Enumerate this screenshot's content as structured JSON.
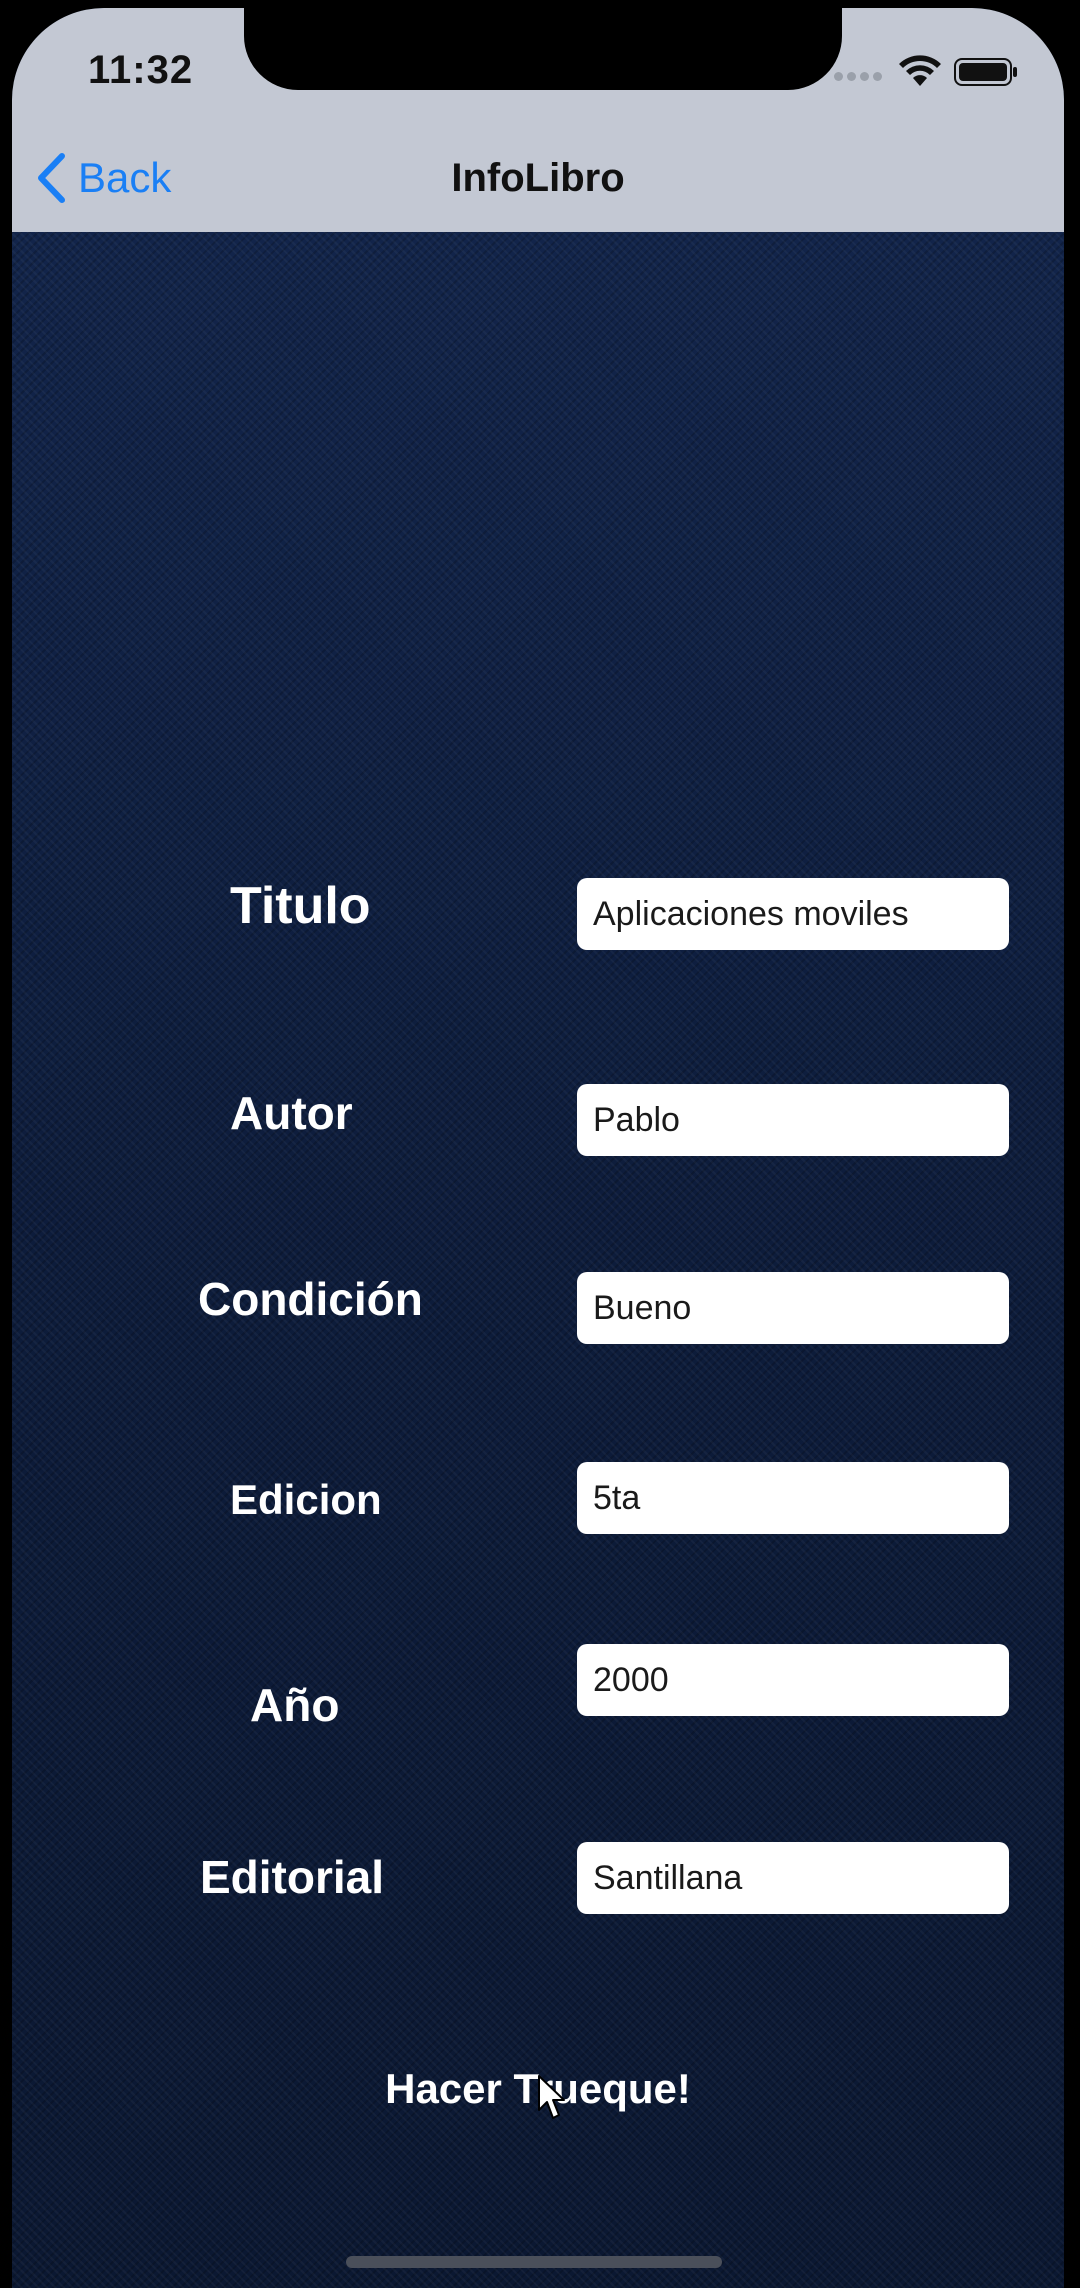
{
  "status_bar": {
    "time": "11:32"
  },
  "nav": {
    "back_label": "Back",
    "title": "InfoLibro"
  },
  "form": {
    "fields": [
      {
        "label": "Titulo",
        "value": "Aplicaciones moviles"
      },
      {
        "label": "Autor",
        "value": "Pablo"
      },
      {
        "label": "Condición",
        "value": "Bueno"
      },
      {
        "label": "Edicion",
        "value": "5ta"
      },
      {
        "label": "Año",
        "value": "2000"
      },
      {
        "label": "Editorial",
        "value": "Santillana"
      }
    ]
  },
  "action": {
    "trade_label": "Hacer Trueque!"
  },
  "colors": {
    "nav_background": "#c3c8d3",
    "accent": "#1a7ff5",
    "content_background": "#0e1d3d",
    "label_text": "#ffffff"
  },
  "icons": [
    "back-chevron-icon",
    "wifi-icon",
    "battery-icon",
    "signal-icon",
    "cursor-icon"
  ]
}
